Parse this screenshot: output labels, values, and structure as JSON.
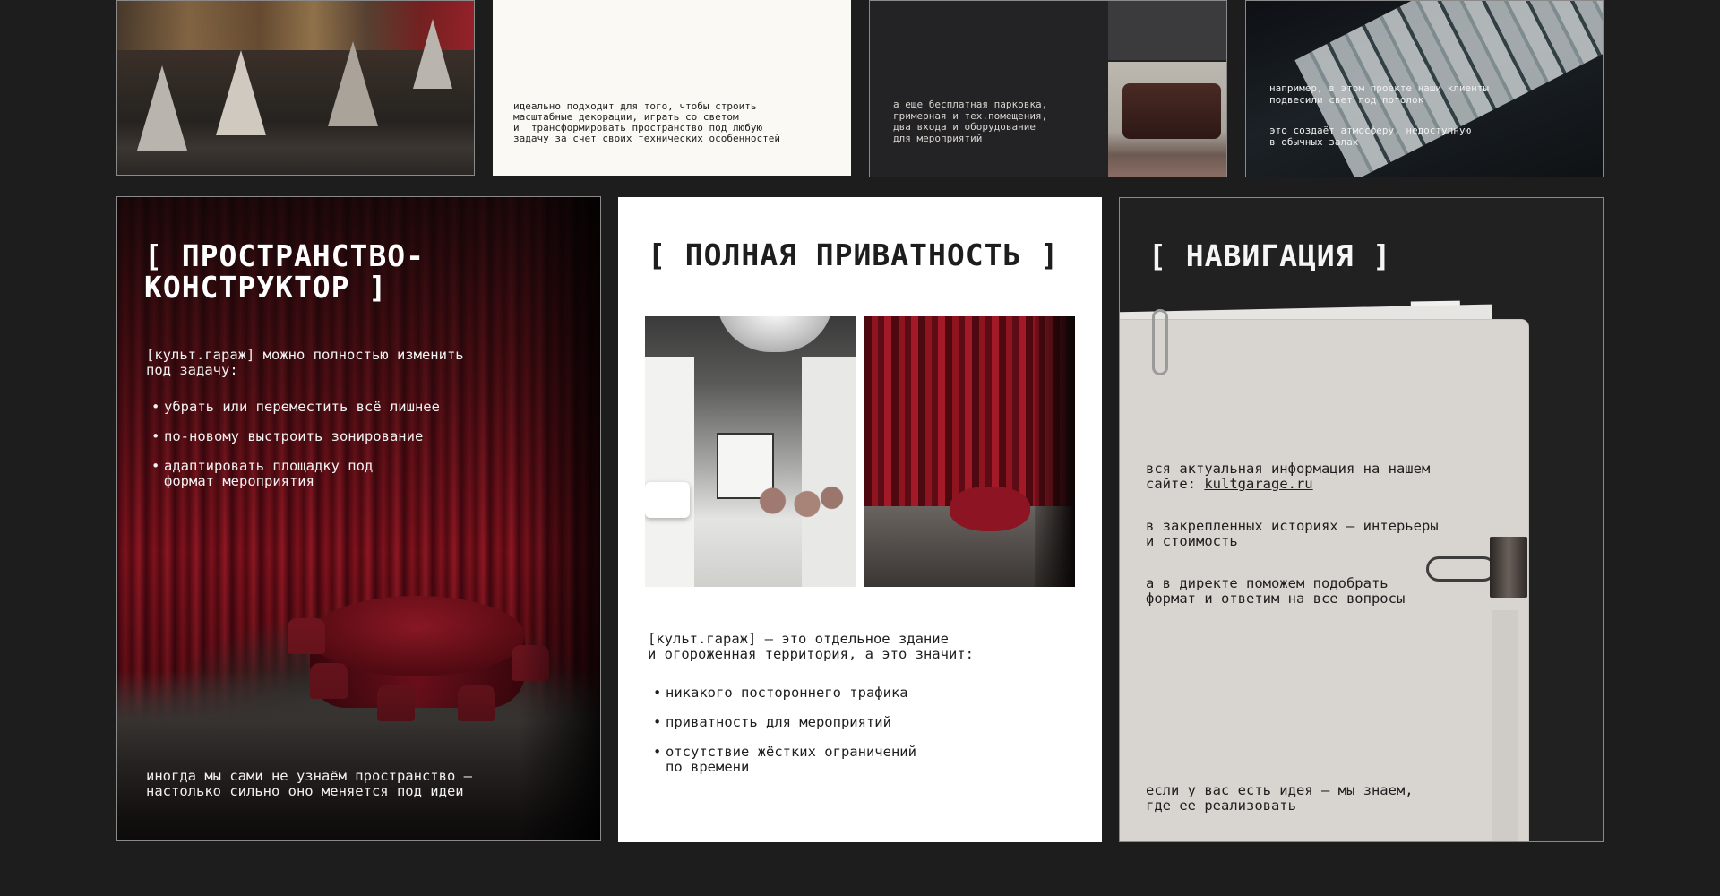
{
  "top_row": {
    "card2_text": "идеально подходит для того, чтобы строить\nмасштабные декорации, играть со светом\nи  трансформировать пространство под любую\nзадачу за счет своих технических особенностей",
    "card3_text": "а еще бесплатная парковка,\nгримерная и тех.помещения,\nдва входа и оборудование\nдля мероприятий",
    "card4_text1": "например, в этом проекте наши клиенты\nподвесили свет под потолок",
    "card4_text2": "это создаёт атмосферу, недоступную\nв обычных залах"
  },
  "constructor": {
    "title": "[ ПРОСТРАНСТВО-\nКОНСТРУКТОР ]",
    "intro": "[культ.гараж] можно полностью изменить\nпод задачу:",
    "bullets": [
      "убрать или переместить всё лишнее",
      "по-новому выстроить зонирование",
      "адаптировать площадку под\nформат мероприятия"
    ],
    "footer": "иногда мы сами не узнаём пространство —\nнастолько сильно оно меняется под идеи"
  },
  "privacy": {
    "title": "[ ПОЛНАЯ ПРИВАТНОСТЬ ]",
    "intro": "[культ.гараж] — это отдельное здание\nи огороженная территория, а это значит:",
    "bullets": [
      "никакого постороннего трафика",
      "приватность для мероприятий",
      "отсутствие жёстких ограничений\nпо времени"
    ]
  },
  "navigation": {
    "title": "[ НАВИГАЦИЯ ]",
    "text1_prefix": "вся актуальная информация на нашем\nсайте: ",
    "site_link": "kultgarage.ru",
    "text2": "в закрепленных историях — интерьеры\nи стоимость",
    "text3": "а в директе поможем подобрать\nформат и ответим на все вопросы",
    "footer": "если у вас есть идея — мы знаем,\nгде ее реализовать"
  },
  "colors": {
    "background": "#1e1d1e",
    "card_white": "#ffffff",
    "curtain_red": "#8f1420",
    "folder_paper": "#d8d4cf"
  }
}
